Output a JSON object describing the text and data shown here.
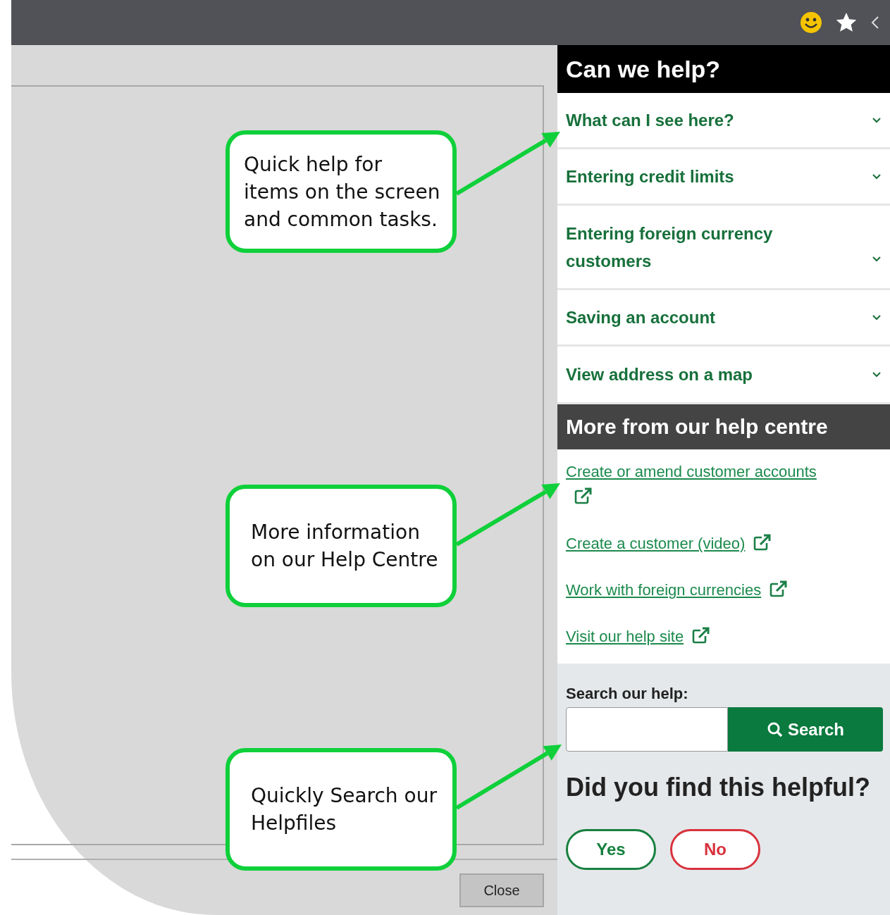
{
  "left_pane": {
    "close_button": "Close"
  },
  "help_panel": {
    "title": "Can we help?",
    "topics": [
      {
        "label": "What can I see here?",
        "expanded": false
      },
      {
        "label": "Entering credit limits",
        "expanded": false
      },
      {
        "label": "Entering foreign currency customers",
        "expanded": false
      },
      {
        "label": "Saving an account",
        "expanded": false
      },
      {
        "label": "View address on a map",
        "expanded": false
      }
    ],
    "more_title": "More from our help centre",
    "links": [
      {
        "label": "Create or amend customer accounts"
      },
      {
        "label": "Create a customer (video)"
      },
      {
        "label": "Work with foreign currencies"
      },
      {
        "label": "Visit our help site"
      }
    ],
    "search": {
      "label": "Search our help:",
      "button": "Search"
    },
    "feedback": {
      "question": "Did you find this helpful?",
      "buttons": [
        {
          "label": "Yes",
          "kind": "positive"
        },
        {
          "label": "No",
          "kind": "negative"
        }
      ]
    }
  },
  "callouts": [
    {
      "text": "Quick help for items on the screen and common tasks."
    },
    {
      "text": "More information on our Help Centre"
    },
    {
      "text": "Quickly Search our Helpfiles"
    }
  ]
}
